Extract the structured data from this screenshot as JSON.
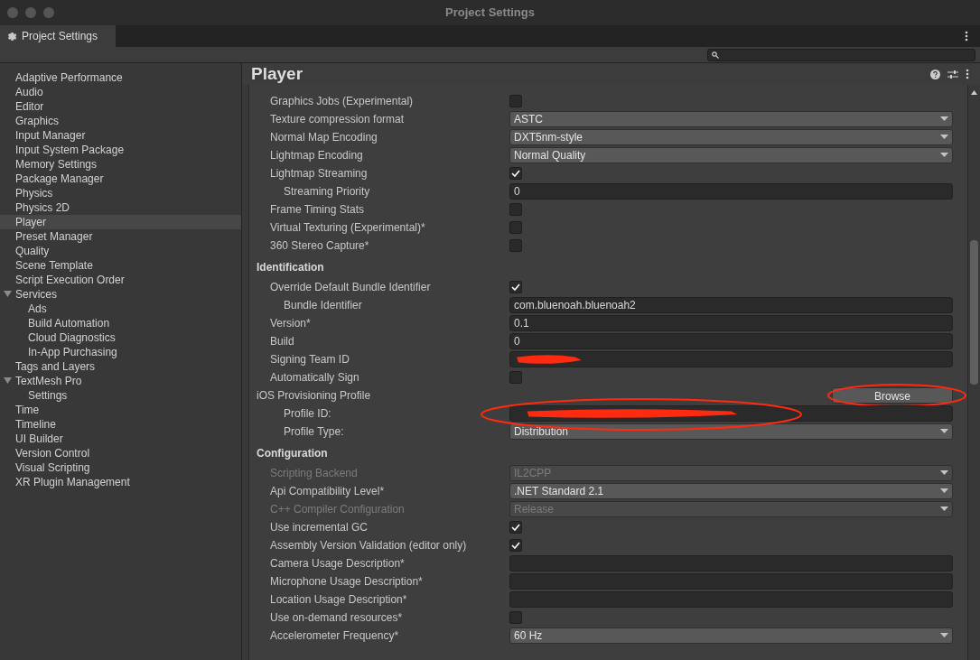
{
  "window": {
    "title": "Project Settings"
  },
  "tab": {
    "label": "Project Settings",
    "selected": true
  },
  "sidebar": {
    "items": [
      {
        "label": "Adaptive Performance",
        "selected": false
      },
      {
        "label": "Audio",
        "selected": false
      },
      {
        "label": "Editor",
        "selected": false
      },
      {
        "label": "Graphics",
        "selected": false
      },
      {
        "label": "Input Manager",
        "selected": false
      },
      {
        "label": "Input System Package",
        "selected": false
      },
      {
        "label": "Memory Settings",
        "selected": false
      },
      {
        "label": "Package Manager",
        "selected": false
      },
      {
        "label": "Physics",
        "selected": false
      },
      {
        "label": "Physics 2D",
        "selected": false
      },
      {
        "label": "Player",
        "selected": true
      },
      {
        "label": "Preset Manager",
        "selected": false
      },
      {
        "label": "Quality",
        "selected": false
      },
      {
        "label": "Scene Template",
        "selected": false
      },
      {
        "label": "Script Execution Order",
        "selected": false
      },
      {
        "label": "Services",
        "selected": false,
        "expanded": true,
        "children": [
          {
            "label": "Ads",
            "selected": false
          },
          {
            "label": "Build Automation",
            "selected": false
          },
          {
            "label": "Cloud Diagnostics",
            "selected": false
          },
          {
            "label": "In-App Purchasing",
            "selected": false
          }
        ]
      },
      {
        "label": "Tags and Layers",
        "selected": false
      },
      {
        "label": "TextMesh Pro",
        "selected": false,
        "expanded": true,
        "children": [
          {
            "label": "Settings",
            "selected": false
          }
        ]
      },
      {
        "label": "Time",
        "selected": false
      },
      {
        "label": "Timeline",
        "selected": false
      },
      {
        "label": "UI Builder",
        "selected": false
      },
      {
        "label": "Version Control",
        "selected": false
      },
      {
        "label": "Visual Scripting",
        "selected": false
      },
      {
        "label": "XR Plugin Management",
        "selected": false
      }
    ]
  },
  "panel": {
    "title": "Player",
    "rows": [
      {
        "kind": "checkbox",
        "label": "Graphics Jobs (Experimental)",
        "checked": false
      },
      {
        "kind": "dropdown",
        "label": "Texture compression format",
        "value": "ASTC",
        "disabled": false
      },
      {
        "kind": "dropdown",
        "label": "Normal Map Encoding",
        "value": "DXT5nm-style",
        "disabled": false
      },
      {
        "kind": "dropdown",
        "label": "Lightmap Encoding",
        "value": "Normal Quality",
        "disabled": false
      },
      {
        "kind": "checkbox",
        "label": "Lightmap Streaming",
        "checked": true,
        "children": [
          {
            "kind": "text",
            "label": "Streaming Priority",
            "value": "0"
          }
        ]
      },
      {
        "kind": "checkbox",
        "label": "Frame Timing Stats",
        "checked": false
      },
      {
        "kind": "checkbox",
        "label": "Virtual Texturing (Experimental)*",
        "checked": false
      },
      {
        "kind": "checkbox",
        "label": "360 Stereo Capture*",
        "checked": false
      },
      {
        "kind": "header",
        "label": "Identification"
      },
      {
        "kind": "checkbox",
        "label": "Override Default Bundle Identifier",
        "checked": true,
        "children": [
          {
            "kind": "text",
            "label": "Bundle Identifier",
            "value": "com.bluenoah.bluenoah2"
          }
        ]
      },
      {
        "kind": "text",
        "label": "Version*",
        "value": "0.1"
      },
      {
        "kind": "text",
        "label": "Build",
        "value": "0"
      },
      {
        "kind": "text",
        "label": "Signing Team ID",
        "redacted": true
      },
      {
        "kind": "checkbox",
        "label": "Automatically Sign",
        "checked": false
      },
      {
        "kind": "button",
        "label": "iOS Provisioning Profile",
        "button": "Browse",
        "circled": true,
        "children": [
          {
            "kind": "text",
            "label": "Profile ID:",
            "redacted": true,
            "circled": true
          },
          {
            "kind": "dropdown",
            "label": "Profile Type:",
            "value": "Distribution",
            "disabled": false
          }
        ]
      },
      {
        "kind": "header",
        "label": "Configuration"
      },
      {
        "kind": "dropdown",
        "label": "Scripting Backend",
        "value": "IL2CPP",
        "disabled": true
      },
      {
        "kind": "dropdown",
        "label": "Api Compatibility Level*",
        "value": ".NET Standard 2.1",
        "disabled": false
      },
      {
        "kind": "dropdown",
        "label": "C++ Compiler Configuration",
        "value": "Release",
        "disabled": true
      },
      {
        "kind": "checkbox",
        "label": "Use incremental GC",
        "checked": true
      },
      {
        "kind": "checkbox",
        "label": "Assembly Version Validation (editor only)",
        "checked": true
      },
      {
        "kind": "text",
        "label": "Camera Usage Description*"
      },
      {
        "kind": "text",
        "label": "Microphone Usage Description*"
      },
      {
        "kind": "text",
        "label": "Location Usage Description*"
      },
      {
        "kind": "checkbox",
        "label": "Use on-demand resources*",
        "checked": false
      },
      {
        "kind": "dropdown",
        "label": "Accelerometer Frequency*",
        "value": "60 Hz",
        "disabled": false
      }
    ]
  }
}
